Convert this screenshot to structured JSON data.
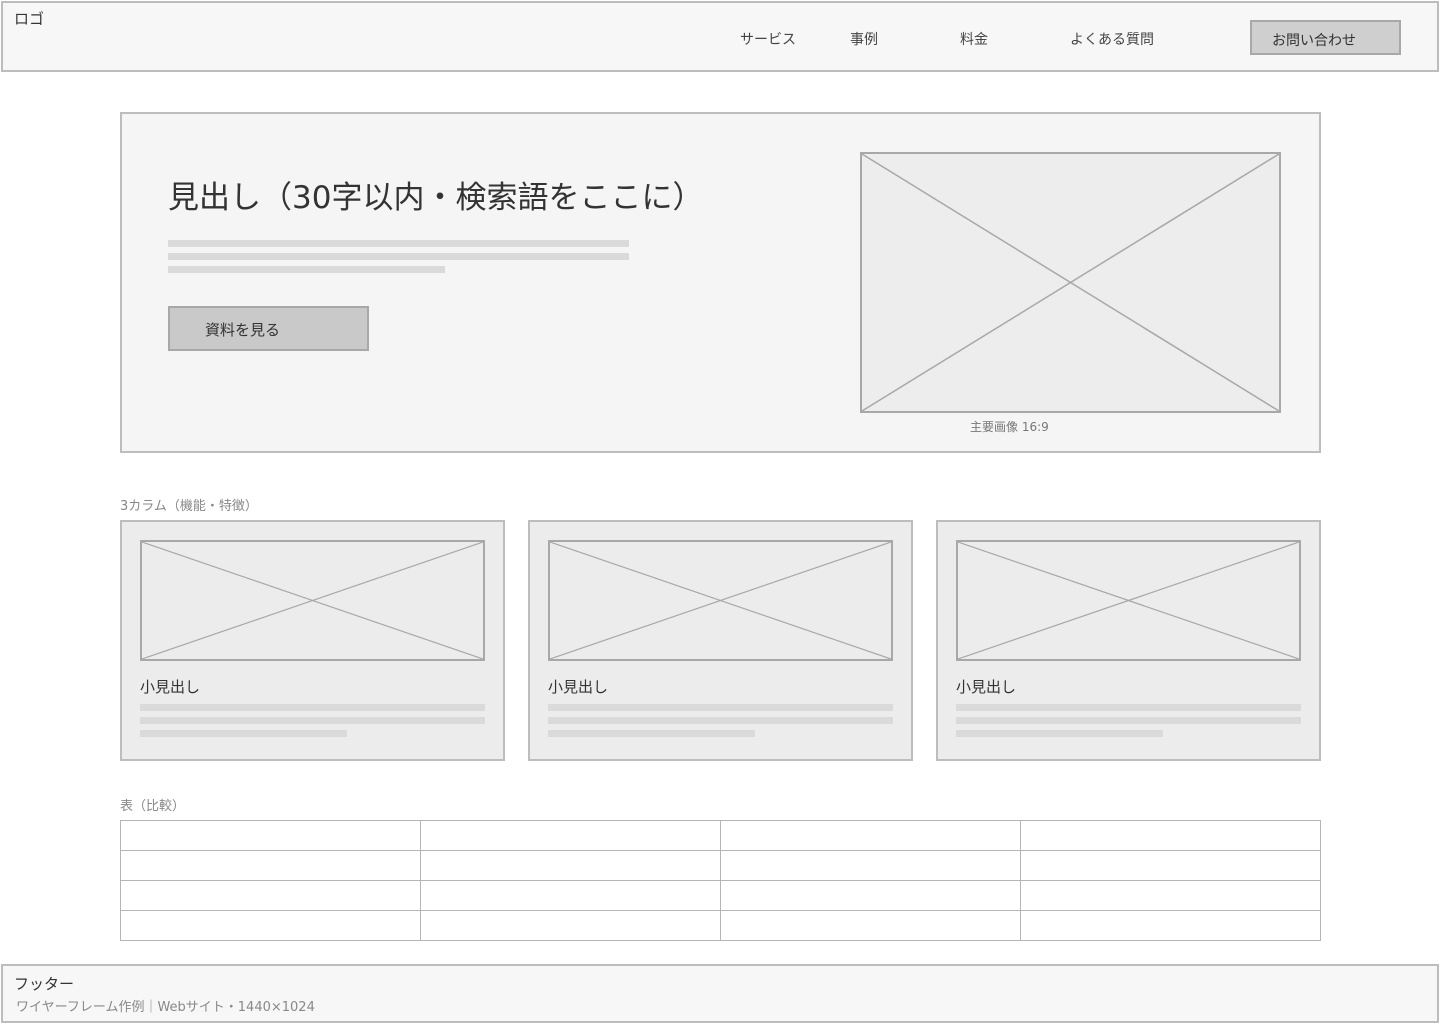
{
  "header": {
    "logo": "ロゴ",
    "nav": [
      {
        "label": "サービス"
      },
      {
        "label": "事例"
      },
      {
        "label": "料金"
      },
      {
        "label": "よくある質問"
      }
    ],
    "contact_label": "お問い合わせ"
  },
  "hero": {
    "title": "見出し（30字以内・検索語をここに）",
    "button_label": "資料を見る",
    "image_caption": "主要画像 16:9"
  },
  "features": {
    "label": "3カラム（機能・特徴）",
    "cards": [
      {
        "title": "小見出し"
      },
      {
        "title": "小見出し"
      },
      {
        "title": "小見出し"
      }
    ]
  },
  "table": {
    "label": "表（比較）"
  },
  "footer": {
    "title": "フッター",
    "subtitle": "ワイヤーフレーム作例｜Webサイト・1440×1024"
  },
  "colors": {
    "border": "#bdbdbd",
    "placeholder_fill": "#ededed",
    "button_fill": "#c9c9c9",
    "text_line": "#dadada"
  }
}
